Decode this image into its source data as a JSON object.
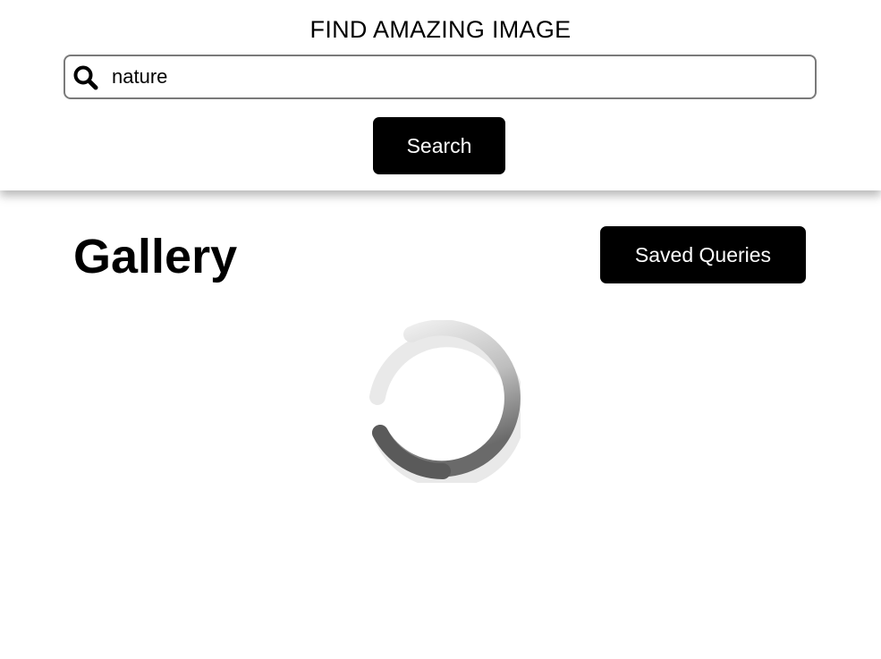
{
  "header": {
    "title": "FIND AMAZING IMAGE",
    "search": {
      "value": "nature",
      "icon": "search-icon"
    },
    "search_button_label": "Search"
  },
  "gallery": {
    "title": "Gallery",
    "saved_queries_label": "Saved Queries",
    "loading_indicator": "spinner-icon"
  },
  "colors": {
    "button_bg": "#000000",
    "button_text": "#ffffff",
    "input_border": "#7a7a7a",
    "spinner_dark": "#4a4a4a",
    "spinner_light": "#eeeeee"
  }
}
